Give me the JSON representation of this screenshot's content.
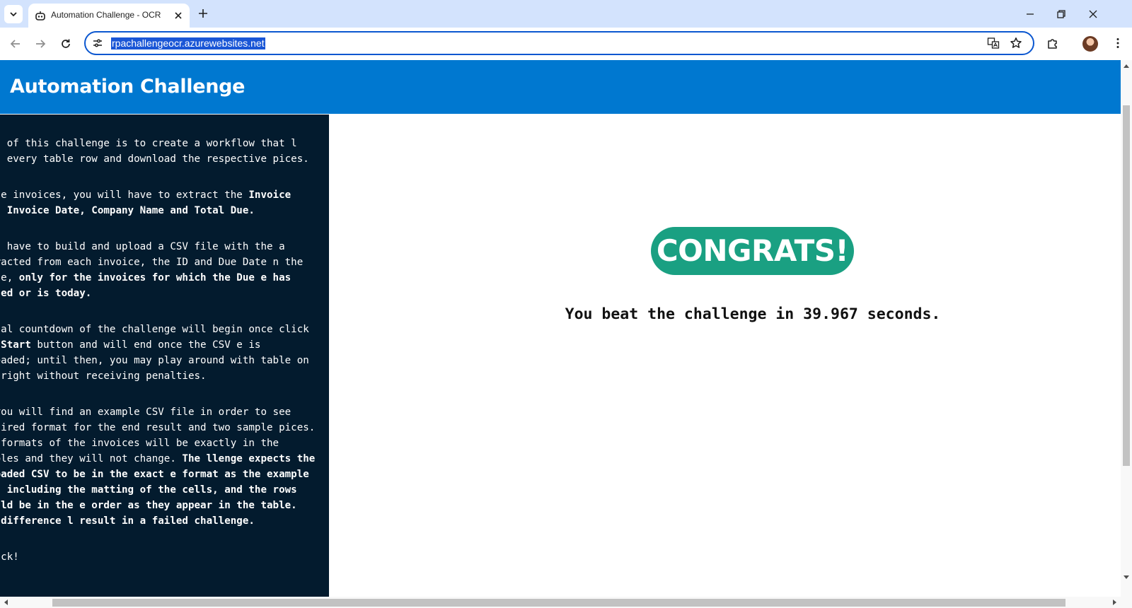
{
  "browser": {
    "tab": {
      "title": "Automation Challenge - OCR"
    },
    "address_bar": {
      "url": "rpachallengeocr.azurewebsites.net"
    }
  },
  "page": {
    "header": {
      "title": "Automation Challenge"
    },
    "instructions": {
      "p1": "goal of this challenge is to create a workflow that l read every table row and download the respective pices.",
      "p2_a": "n the invoices, you will have to extract the ",
      "p2_b": "Invoice per, Invoice Date, Company Name and Total Due.",
      "p3_a": "will have to build and upload a CSV file with the a extracted from each invoice, the ID and Due Date n the table, ",
      "p3_b": "only for the invoices for which the Due e has passed or is today.",
      "p4_a": "actual countdown of the challenge will begin once click the ",
      "p4_b": "Start",
      "p4_c": " button and will end once the CSV e is uploaded; until then, you may play around with table on the right without receiving penalties.",
      "p5_a": "ow you will find an example CSV file in order to see required format for the end result and two sample pices. The formats of the invoices will be exactly in the samples and they will not change. ",
      "p5_b": "The llenge expects the uploaded CSV to be in the exact e format as the example CSV, including the matting of the cells, and the rows should be in the e order as they appear in the table. Any difference l result in a failed challenge.",
      "p6": "d luck!"
    },
    "congrats_badge": "CONGRATS!",
    "result_message": "You beat the challenge in 39.967 seconds."
  },
  "colors": {
    "header_bg": "#0078d0",
    "sidebar_bg": "#031b2e",
    "badge_bg": "#1aa082",
    "tabbar_bg": "#d3e3fd",
    "omnibox_border": "#0b57d0"
  }
}
